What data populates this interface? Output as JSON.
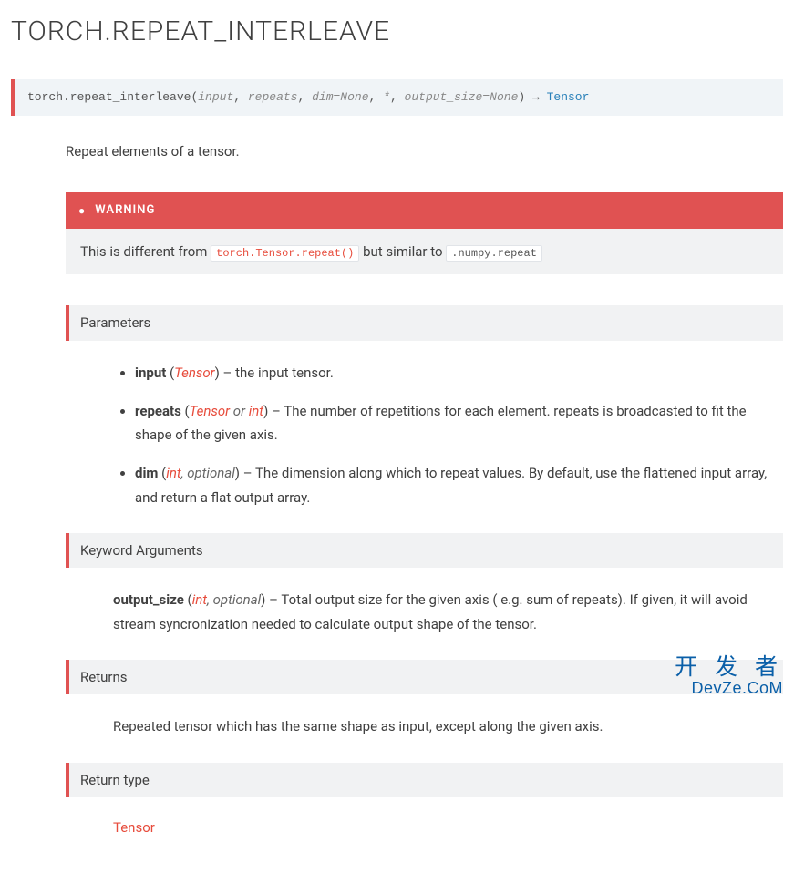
{
  "page": {
    "title": "TORCH.REPEAT_INTERLEAVE"
  },
  "signature": {
    "qualname": "torch.repeat_interleave",
    "open": "(",
    "params": {
      "p1": "input",
      "sep1": ", ",
      "p2": "repeats",
      "sep2": ", ",
      "p3": "dim=None",
      "sep3": ", ",
      "star": "*",
      "sep4": ", ",
      "p4": "output_size=None"
    },
    "close": ")",
    "arrow": " → ",
    "return_type": "Tensor"
  },
  "description": "Repeat elements of a tensor.",
  "warning": {
    "label": "WARNING",
    "text_a": "This is different from ",
    "code_a": "torch.Tensor.repeat()",
    "text_b": " but similar to ",
    "code_b": ".numpy.repeat"
  },
  "sections": {
    "parameters": {
      "header": "Parameters",
      "items": [
        {
          "name": "input",
          "types": "Tensor",
          "desc": " – the input tensor."
        },
        {
          "name": "repeats",
          "types": "Tensor or int",
          "desc": " – The number of repetitions for each element. repeats is broadcasted to fit the shape of the given axis."
        },
        {
          "name": "dim",
          "types": "int, optional",
          "desc": " – The dimension along which to repeat values. By default, use the flattened input array, and return a flat output array."
        }
      ]
    },
    "keyword_arguments": {
      "header": "Keyword Arguments",
      "item": {
        "name": "output_size",
        "types": "int, optional",
        "desc": " – Total output size for the given axis ( e.g. sum of repeats). If given, it will avoid stream syncronization needed to calculate output shape of the tensor."
      }
    },
    "returns": {
      "header": "Returns",
      "text": "Repeated tensor which has the same shape as input, except along the given axis."
    },
    "return_type": {
      "header": "Return type",
      "text": "Tensor"
    }
  },
  "param_types": {
    "p0_tensor": "Tensor",
    "p1_tensor": "Tensor",
    "p1_or": " or ",
    "p1_int": "int",
    "p2_int": "int",
    "p2_sep": ", ",
    "p2_optional": "optional",
    "kw_int": "int",
    "kw_sep": ", ",
    "kw_optional": "optional"
  },
  "watermark": {
    "cn": "开 发 者",
    "en": "DevZe.CoM"
  }
}
